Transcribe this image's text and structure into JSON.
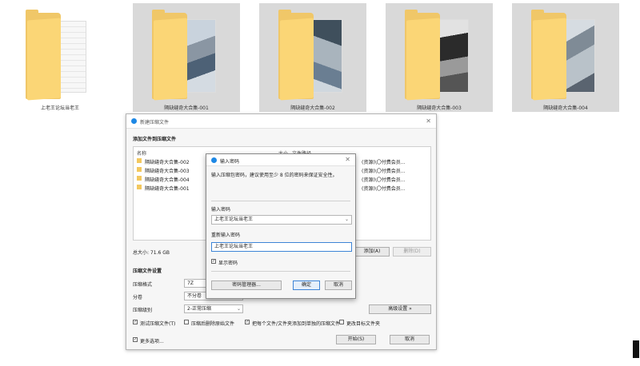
{
  "folders": [
    {
      "name": "上老王论坛当老王",
      "selected": false
    },
    {
      "name": "隔缺缝奇大合集-001",
      "selected": true
    },
    {
      "name": "隔缺缝奇大合集-002",
      "selected": true
    },
    {
      "name": "隔缺缝奇大合集-003",
      "selected": true
    },
    {
      "name": "隔缺缝奇大合集-004",
      "selected": true
    }
  ],
  "dialog": {
    "title": "新建压缩文件",
    "section_add": "添加文件到压缩文件",
    "columns": {
      "name": "名称",
      "size": "大小",
      "path": "文件路径"
    },
    "files": [
      {
        "name": "隔缺缝奇大合集-002",
        "path": "(资源)\\〇付费会员..."
      },
      {
        "name": "隔缺缝奇大合集-003",
        "path": "(资源)\\〇付费会员..."
      },
      {
        "name": "隔缺缝奇大合集-004",
        "path": "(资源)\\〇付费会员..."
      },
      {
        "name": "隔缺缝奇大合集-001",
        "path": "(资源)\\〇付费会员..."
      }
    ],
    "total_size": "总大小: 71.6 GB",
    "add_button": "添加(A)",
    "delete_button": "删除(D)",
    "section_settings": "压缩文件设置",
    "format_label": "压缩格式",
    "format_value": "7Z",
    "split_label": "分卷",
    "split_value": "不分卷",
    "level_label": "压缩级别",
    "level_value": "2-正常压缩",
    "advanced_button": "高级设置 »",
    "options": [
      {
        "label": "测试压缩文件(T)",
        "checked": true
      },
      {
        "label": "压缩后删除原始文件",
        "checked": false
      },
      {
        "label": "把每个文件/文件夹添加到单独的压缩文件",
        "checked": true
      },
      {
        "label": "更改目标文件夹",
        "checked": false
      }
    ],
    "more_options": "更多选项...",
    "more_options_checked": true,
    "start_button": "开始(S)",
    "cancel_button": "取消"
  },
  "password_dialog": {
    "title": "输入密码",
    "description": "输入压缩包密码，建议使用至少 8 位的密码来保证安全性。",
    "password_label": "输入密码",
    "password_value": "上老王论坛当老王",
    "confirm_label": "重新输入密码",
    "confirm_value": "上老王论坛当老王",
    "show_password": "显示密码",
    "show_password_checked": true,
    "manager_button": "密码管理器...",
    "ok_button": "确定",
    "cancel_button": "取消"
  },
  "colors": {
    "folder": "#f0c768",
    "folder_front": "#fbd676",
    "selection": "#d9d9d9",
    "accent": "#1e88e5",
    "focus": "#3d84d6"
  },
  "icons": [
    "folder-icon",
    "app-logo-icon",
    "close-icon",
    "chevron-down-icon",
    "checkbox-icon"
  ]
}
